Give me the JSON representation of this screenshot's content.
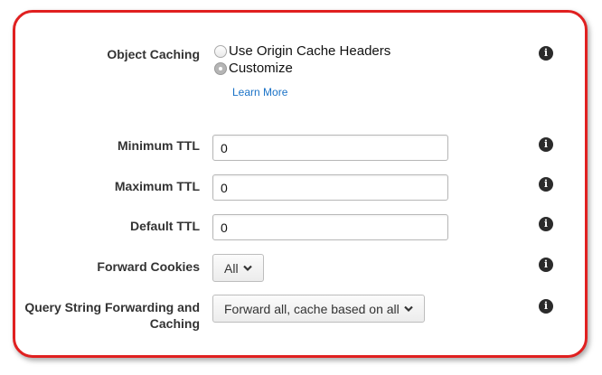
{
  "object_caching": {
    "label": "Object Caching",
    "options": [
      {
        "label": "Use Origin Cache Headers",
        "selected": false
      },
      {
        "label": "Customize",
        "selected": true
      }
    ],
    "learn_more": "Learn More"
  },
  "minimum_ttl": {
    "label": "Minimum TTL",
    "value": "0"
  },
  "maximum_ttl": {
    "label": "Maximum TTL",
    "value": "0"
  },
  "default_ttl": {
    "label": "Default TTL",
    "value": "0"
  },
  "forward_cookies": {
    "label": "Forward Cookies",
    "value": "All"
  },
  "query_string": {
    "label_line1": "Query String Forwarding and",
    "label_line2": "Caching",
    "value": "Forward all, cache based on all"
  },
  "info_glyph": "i",
  "icons": {
    "info": "info-icon",
    "dropdown": "chevron-down-icon"
  },
  "colors": {
    "frame_border": "#e02020",
    "link": "#1a72c7"
  }
}
